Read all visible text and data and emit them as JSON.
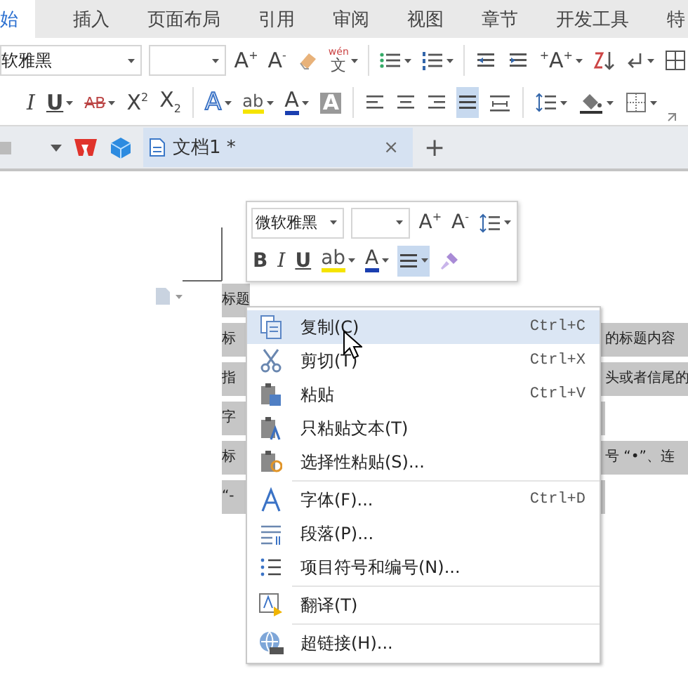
{
  "ribbon_tabs": [
    {
      "label": "始",
      "selected": true
    },
    {
      "label": "插入",
      "selected": false
    },
    {
      "label": "页面布局",
      "selected": false
    },
    {
      "label": "引用",
      "selected": false
    },
    {
      "label": "审阅",
      "selected": false
    },
    {
      "label": "视图",
      "selected": false
    },
    {
      "label": "章节",
      "selected": false
    },
    {
      "label": "开发工具",
      "selected": false
    },
    {
      "label": "特",
      "selected": false
    }
  ],
  "formatting_toolbar": {
    "font_field": {
      "value": "软雅黑"
    },
    "top_row": [
      {
        "kind": "glyph",
        "text": "A$^{+}$",
        "dropdown": false
      },
      {
        "kind": "glyph",
        "text": "A$^{-}$",
        "dropdown": false
      },
      {
        "kind": "icon",
        "dropdown": false
      },
      {
        "kind": "ruby",
        "pinyin": "wén",
        "text": "文",
        "dropdown": true
      },
      {
        "kind": "separator"
      },
      {
        "kind": "icon",
        "dropdown": true
      },
      {
        "kind": "icon",
        "dropdown": true
      },
      {
        "kind": "separator"
      },
      {
        "kind": "icon",
        "dropdown": false
      },
      {
        "kind": "icon",
        "dropdown": false
      },
      {
        "kind": "glyph",
        "text": "$^{+}$A$^{+}$",
        "dropdown": true
      },
      {
        "kind": "icon",
        "dropdown": false
      },
      {
        "kind": "icon",
        "dropdown": true
      },
      {
        "kind": "icon",
        "dropdown": false
      }
    ],
    "bottom_row": [
      {
        "kind": "glyph",
        "text": "I",
        "dropdown": false
      },
      {
        "kind": "glyph",
        "text": "U",
        "dropdown": true
      },
      {
        "kind": "glyph",
        "text": "AB",
        "dropdown": true
      },
      {
        "kind": "glyph",
        "text": "X$^{2}$",
        "dropdown": false
      },
      {
        "kind": "glyph",
        "text": "X$_{2}$",
        "dropdown": false
      },
      {
        "kind": "separator"
      },
      {
        "kind": "glyph",
        "text": "A",
        "dropdown": true
      },
      {
        "kind": "glyph",
        "text": "ab",
        "dropdown": true
      },
      {
        "kind": "glyph",
        "text": "A",
        "dropdown": true
      },
      {
        "kind": "glyph",
        "text": "A",
        "dropdown": false
      },
      {
        "kind": "separator"
      },
      {
        "kind": "icon",
        "dropdown": false,
        "selected": false
      },
      {
        "kind": "icon",
        "dropdown": false,
        "selected": false
      },
      {
        "kind": "icon",
        "dropdown": false,
        "selected": false
      },
      {
        "kind": "icon",
        "dropdown": false,
        "selected": true
      },
      {
        "kind": "icon",
        "dropdown": false,
        "selected": false
      },
      {
        "kind": "separator"
      },
      {
        "kind": "icon",
        "dropdown": true
      },
      {
        "kind": "icon",
        "dropdown": true
      },
      {
        "kind": "icon",
        "dropdown": true
      }
    ]
  },
  "document_tabs": [
    {
      "title": "文档1 *",
      "close": "×",
      "selected": true
    }
  ],
  "new_tab": "+",
  "document_lines": [
    {
      "left": "标题"
    },
    {
      "left": "标",
      "right": "的标题内容"
    },
    {
      "left": "指",
      "right": "头或者信尾的"
    },
    {
      "left": "字"
    },
    {
      "left": "标",
      "right": "号 “•”、连"
    },
    {
      "left": "“-"
    }
  ],
  "mini_toolbar": {
    "font_field": {
      "value": "微软雅黑"
    },
    "top_row": [
      {
        "kind": "glyph",
        "text": "A$^{+}$",
        "dropdown": false
      },
      {
        "kind": "glyph",
        "text": "A$^{-}$",
        "dropdown": false
      },
      {
        "kind": "icon",
        "dropdown": true
      }
    ],
    "bottom_row": [
      {
        "kind": "glyph",
        "text": "B",
        "dropdown": false
      },
      {
        "kind": "glyph",
        "text": "I",
        "dropdown": false
      },
      {
        "kind": "glyph",
        "text": "U",
        "dropdown": false
      },
      {
        "kind": "glyph",
        "text": "ab",
        "dropdown": true
      },
      {
        "kind": "glyph",
        "text": "A",
        "dropdown": true
      },
      {
        "kind": "icon",
        "dropdown": true,
        "selected": true
      },
      {
        "kind": "icon",
        "dropdown": false
      }
    ]
  },
  "context_menu": [
    {
      "kind": "item",
      "label": "复制(C)",
      "shortcut": "Ctrl+C",
      "selected": true
    },
    {
      "kind": "item",
      "label": "剪切(T)",
      "shortcut": "Ctrl+X",
      "selected": false
    },
    {
      "kind": "item",
      "label": "粘贴",
      "shortcut": "Ctrl+V",
      "selected": false
    },
    {
      "kind": "item",
      "label": "只粘贴文本(T)",
      "selected": false
    },
    {
      "kind": "item",
      "label": "选择性粘贴(S)...",
      "selected": false
    },
    {
      "kind": "separator"
    },
    {
      "kind": "item",
      "label": "字体(F)...",
      "shortcut": "Ctrl+D",
      "selected": false
    },
    {
      "kind": "item",
      "label": "段落(P)...",
      "selected": false
    },
    {
      "kind": "item",
      "label": "项目符号和编号(N)...",
      "selected": false
    },
    {
      "kind": "separator"
    },
    {
      "kind": "item",
      "label": "翻译(T)",
      "selected": false
    },
    {
      "kind": "separator"
    },
    {
      "kind": "item",
      "label": "超链接(H)...",
      "selected": false
    }
  ]
}
